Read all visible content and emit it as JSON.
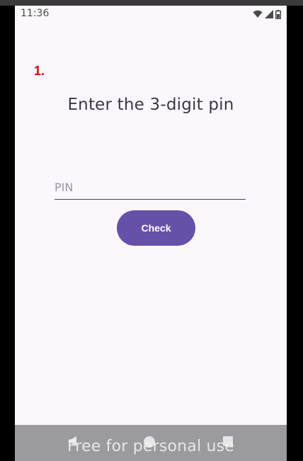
{
  "status_bar": {
    "time": "11:36",
    "icons": [
      "wifi-icon",
      "signal-icon",
      "battery-icon"
    ]
  },
  "main": {
    "step_number": "1.",
    "title": "Enter the 3-digit pin",
    "pin_input": {
      "value": "",
      "placeholder": "PIN"
    },
    "check_button_label": "Check"
  },
  "navigation_bar": {
    "icons": [
      "back-icon",
      "home-icon",
      "recents-icon"
    ]
  },
  "watermark": "Free for personal use",
  "colors": {
    "background": "#fcf7fd",
    "accent": "#6651a9",
    "step_number": "#e60000",
    "title_text": "#3b3a44",
    "nav_bar": "#9b9a9e"
  }
}
